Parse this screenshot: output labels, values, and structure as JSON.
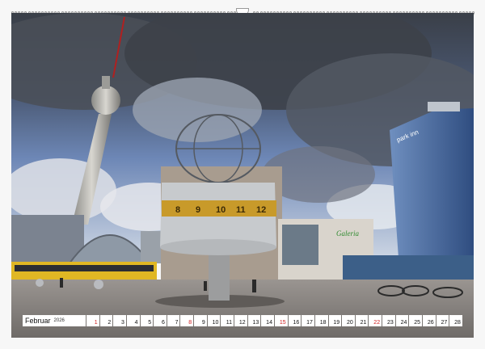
{
  "calendar": {
    "month": "Februar",
    "year": "2026",
    "days": [
      "1",
      "2",
      "3",
      "4",
      "5",
      "6",
      "7",
      "8",
      "9",
      "10",
      "11",
      "12",
      "13",
      "14",
      "15",
      "16",
      "17",
      "18",
      "19",
      "20",
      "21",
      "22",
      "23",
      "24",
      "25",
      "26",
      "27",
      "28"
    ],
    "sundays": [
      "1",
      "8",
      "15",
      "22"
    ]
  },
  "photo": {
    "building_sign": "park inn",
    "store_sign": "Galeria",
    "clock_numbers": [
      "8",
      "9",
      "10",
      "11",
      "12"
    ]
  },
  "colors": {
    "sky": "#5b7fb8",
    "cloud_dark": "#3f444d",
    "pavement": "#8d8a87",
    "sunday": "#d02020",
    "clock_gold": "#c89a2a"
  }
}
